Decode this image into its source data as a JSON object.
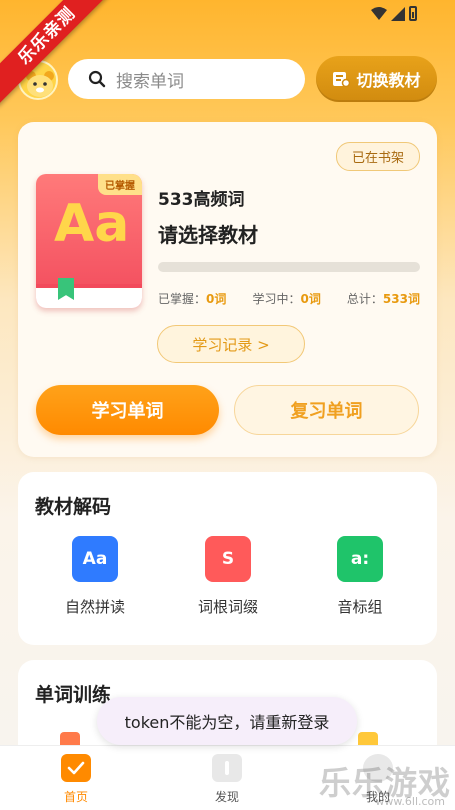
{
  "ribbon": {
    "text": "乐乐亲测"
  },
  "header": {
    "search_placeholder": "搜索单词",
    "switch_label": "切换教材"
  },
  "book_card": {
    "shelf_badge": "已在书架",
    "cover_tag": "已掌握",
    "cover_glyph": "Aa",
    "book_name": "533高频词",
    "select_tip": "请选择教材",
    "progress": 0,
    "stats": [
      {
        "label": "已掌握：",
        "value": "0词"
      },
      {
        "label": "学习中：",
        "value": "0词"
      },
      {
        "label": "总计：",
        "value": "533词"
      }
    ],
    "record_button": "学习记录 >",
    "study_button": "学习单词",
    "review_button": "复习单词"
  },
  "decode": {
    "title": "教材解码",
    "items": [
      {
        "label": "自然拼读",
        "glyph": "Aa",
        "color": "#2f7bff"
      },
      {
        "label": "词根词缀",
        "glyph": "S",
        "color": "#ff5a5a"
      },
      {
        "label": "音标组",
        "glyph": "a:",
        "color": "#1fc46a"
      }
    ]
  },
  "training": {
    "title": "单词训练"
  },
  "toast": {
    "text": "token不能为空，请重新登录"
  },
  "tabbar": {
    "items": [
      {
        "label": "首页",
        "active": true
      },
      {
        "label": "发现",
        "active": false
      },
      {
        "label": "我的",
        "active": false
      }
    ]
  },
  "watermark": {
    "text": "乐乐游戏",
    "url": "www.6ll.com"
  },
  "colors": {
    "accent": "#ff8a00",
    "brand": "#ffb52e"
  }
}
